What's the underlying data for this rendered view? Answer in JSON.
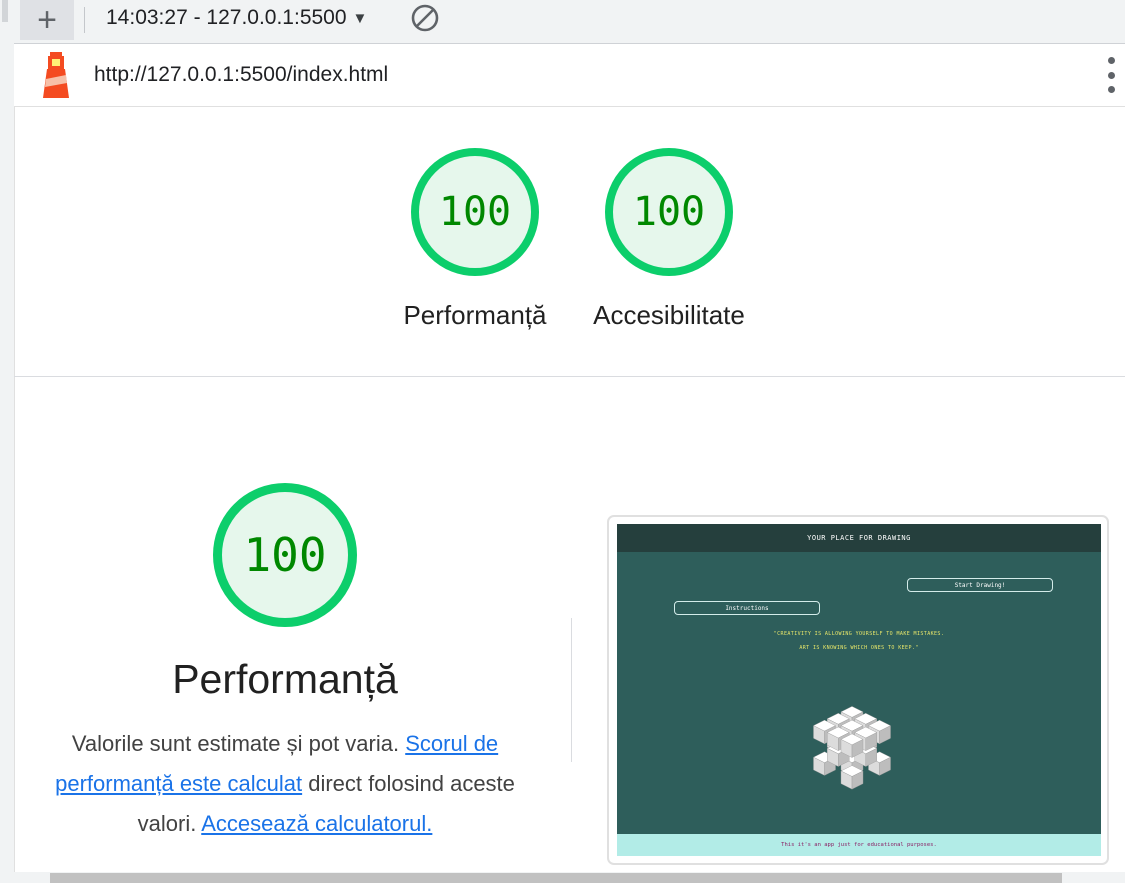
{
  "toolbar": {
    "new_label": "+",
    "report_label": "14:03:27 - 127.0.0.1:5500",
    "caret": "▼"
  },
  "urlbar": {
    "url": "http://127.0.0.1:5500/index.html"
  },
  "summary": {
    "gauges": [
      {
        "score": "100",
        "label": "Performanță"
      },
      {
        "score": "100",
        "label": "Accesibilitate"
      }
    ]
  },
  "performance": {
    "score": "100",
    "title": "Performanță",
    "desc_1": "Valorile sunt estimate și pot varia. ",
    "link_1": "Scorul de performanță este calculat",
    "desc_2": " direct folosind aceste valori. ",
    "link_2": "Accesează calculatorul."
  },
  "screenshot": {
    "header": "YOUR PLACE FOR DRAWING",
    "start_button": "Start Drawing!",
    "instructions_button": "Instructions",
    "quote_line_1": "\"CREATIVITY IS ALLOWING YOURSELF TO MAKE MISTAKES.",
    "quote_line_2": "ART IS KNOWING WHICH ONES TO KEEP.\"",
    "footer": "This it's an app just for educational purposes."
  },
  "colors": {
    "pass_green": "#0cce6b",
    "score_text": "#008800",
    "link": "#1a73e8"
  }
}
